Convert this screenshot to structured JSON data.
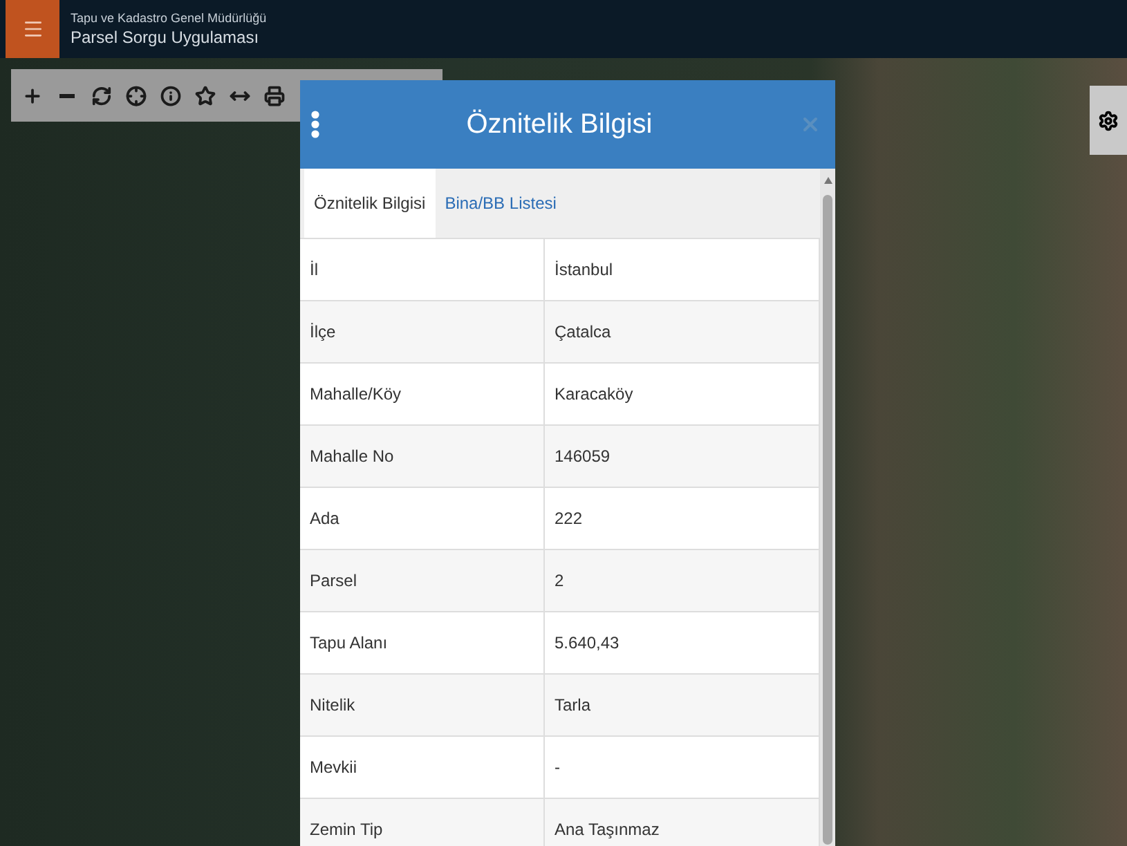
{
  "header": {
    "org": "Tapu ve Kadastro Genel Müdürlüğü",
    "app": "Parsel Sorgu Uygulaması"
  },
  "dialog": {
    "title": "Öznitelik Bilgisi",
    "tabs": [
      {
        "label": "Öznitelik Bilgisi",
        "selected": true
      },
      {
        "label": "Bina/BB Listesi",
        "selected": false
      }
    ],
    "rows": [
      {
        "field": "İl",
        "value": "İstanbul"
      },
      {
        "field": "İlçe",
        "value": "Çatalca"
      },
      {
        "field": "Mahalle/Köy",
        "value": "Karacaköy"
      },
      {
        "field": "Mahalle No",
        "value": "146059"
      },
      {
        "field": "Ada",
        "value": "222"
      },
      {
        "field": "Parsel",
        "value": "2"
      },
      {
        "field": "Tapu Alanı",
        "value": "5.640,43"
      },
      {
        "field": "Nitelik",
        "value": "Tarla"
      },
      {
        "field": "Mevkii",
        "value": "-"
      },
      {
        "field": "Zemin Tip",
        "value": "Ana Taşınmaz"
      }
    ]
  }
}
